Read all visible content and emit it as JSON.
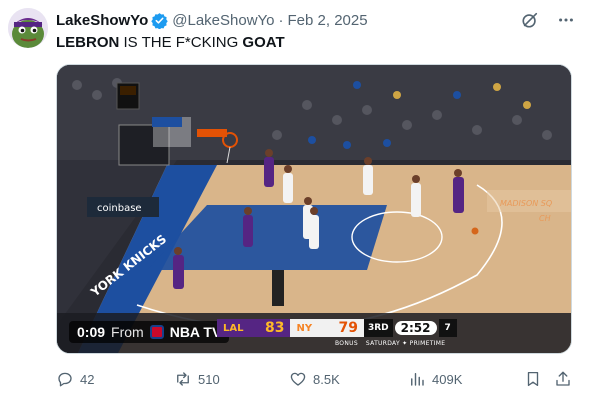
{
  "tweet": {
    "display_name": "LakeShowYo",
    "handle": "@LakeShowYo",
    "separator": "·",
    "date": "Feb 2, 2025",
    "text_parts": [
      "LEBRON",
      " IS THE F*CKING ",
      "GOAT"
    ],
    "verified": true
  },
  "media": {
    "time": "0:09",
    "from_label": "From",
    "source": "NBA TV",
    "scorebug": {
      "team1": "LAL",
      "score1": "83",
      "team2": "NY",
      "score2": "79",
      "quarter": "3RD",
      "clock": "2:52",
      "shot_clock": "7",
      "sub_left": "BONUS",
      "sub_right": "SATURDAY ✦ PRIMETIME"
    },
    "arena_text": {
      "baseline": "YORK KNICKS",
      "sponsor": "coinbase",
      "right_wall": "MADISON SQ",
      "center_logo": "CH"
    }
  },
  "actions": {
    "reply_count": "42",
    "retweet_count": "510",
    "like_count": "8.5K",
    "views_count": "409K"
  },
  "colors": {
    "accent": "#1d9bf0",
    "muted": "#536471",
    "lakers_purple": "#552583",
    "lakers_gold": "#fdb927",
    "knicks_blue": "#1d4fa0",
    "knicks_orange": "#f58426"
  },
  "icons": {
    "verified": "verified-badge-icon",
    "grok": "grok-icon",
    "more": "more-icon",
    "reply": "reply-icon",
    "retweet": "retweet-icon",
    "like": "heart-icon",
    "views": "views-icon",
    "bookmark": "bookmark-icon",
    "share": "share-icon"
  }
}
